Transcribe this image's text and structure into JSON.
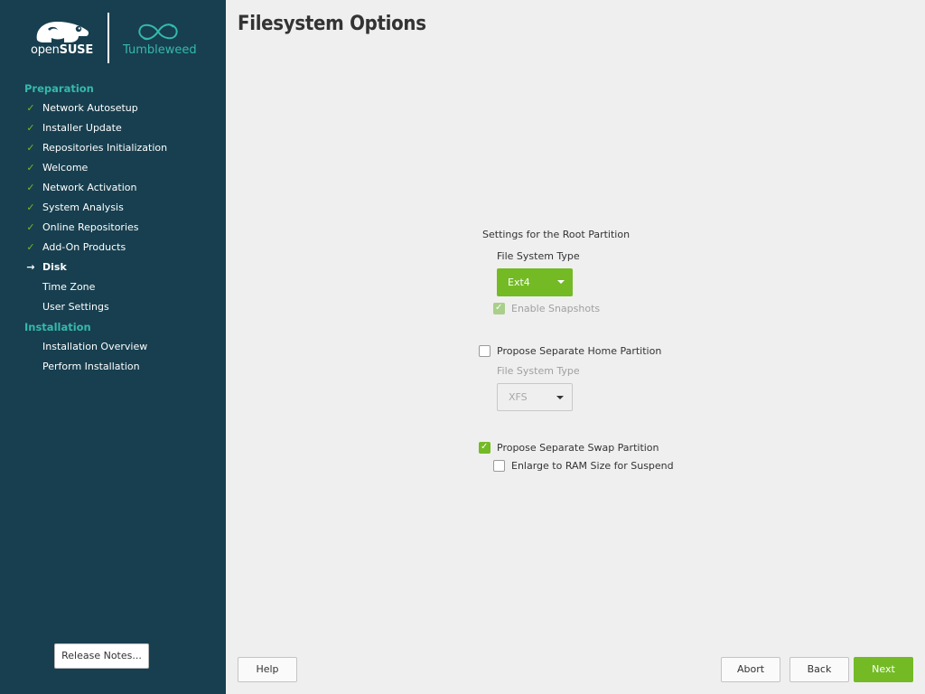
{
  "sidebar": {
    "logo_open": "open",
    "logo_suse": "SUSE",
    "logo_tumbleweed": "Tumbleweed",
    "sections": [
      {
        "title": "Preparation",
        "steps": [
          {
            "label": "Network Autosetup",
            "state": "done"
          },
          {
            "label": "Installer Update",
            "state": "done"
          },
          {
            "label": "Repositories Initialization",
            "state": "done"
          },
          {
            "label": "Welcome",
            "state": "done"
          },
          {
            "label": "Network Activation",
            "state": "done"
          },
          {
            "label": "System Analysis",
            "state": "done"
          },
          {
            "label": "Online Repositories",
            "state": "done"
          },
          {
            "label": "Add-On Products",
            "state": "done"
          },
          {
            "label": "Disk",
            "state": "current"
          },
          {
            "label": "Time Zone",
            "state": "pending"
          },
          {
            "label": "User Settings",
            "state": "pending"
          }
        ]
      },
      {
        "title": "Installation",
        "steps": [
          {
            "label": "Installation Overview",
            "state": "pending"
          },
          {
            "label": "Perform Installation",
            "state": "pending"
          }
        ]
      }
    ],
    "release_notes_button": "Release Notes..."
  },
  "page_title": "Filesystem Options",
  "root": {
    "heading": "Settings for the Root Partition",
    "fs_label": "File System Type",
    "fs_value": "Ext4",
    "snapshots_label": "Enable Snapshots",
    "snapshots_checked": true
  },
  "home": {
    "propose_label": "Propose Separate Home Partition",
    "propose_checked": false,
    "fs_label": "File System Type",
    "fs_value": "XFS"
  },
  "swap": {
    "propose_label": "Propose Separate Swap Partition",
    "propose_checked": true,
    "enlarge_label": "Enlarge to RAM Size for Suspend",
    "enlarge_checked": false
  },
  "buttons": {
    "help": "Help",
    "abort": "Abort",
    "back": "Back",
    "next": "Next"
  },
  "colors": {
    "sidebar_bg": "#173f4f",
    "accent_green": "#73ba25",
    "teal": "#35b9ab"
  }
}
